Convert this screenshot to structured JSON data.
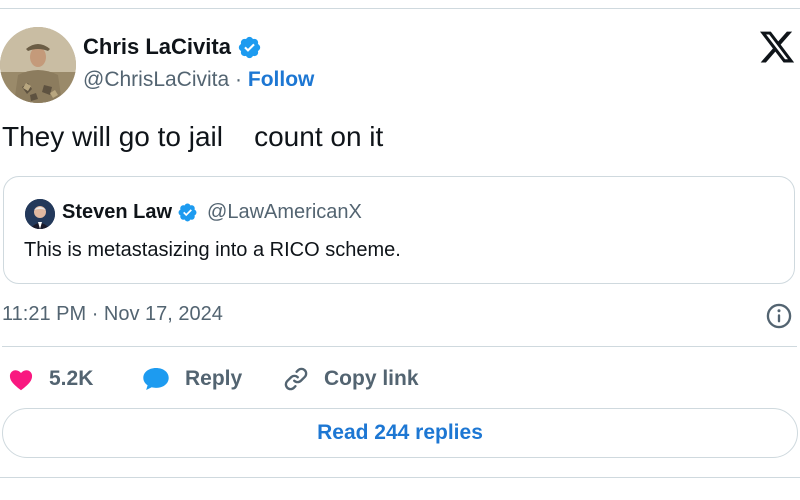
{
  "author": {
    "name": "Chris LaCivita",
    "handle": "@ChrisLaCivita",
    "separator": "·",
    "follow_label": "Follow"
  },
  "tweet": {
    "text": "They will go to jail    count on it"
  },
  "quote": {
    "name": "Steven Law",
    "handle": "@LawAmericanX",
    "text": "This is metastasizing into a RICO scheme."
  },
  "timestamp": {
    "time": "11:21 PM",
    "separator": "·",
    "date": "Nov 17, 2024"
  },
  "actions": {
    "likes_count": "5.2K",
    "reply_label": "Reply",
    "copy_link_label": "Copy link"
  },
  "read_replies_label": "Read 244 replies",
  "colors": {
    "accent": "#1d77d3",
    "like_heart": "#f91880",
    "reply_bubble": "#1d9bf0",
    "verified": "#1d9bf0",
    "muted_text": "#536471",
    "border": "#cfd9de"
  },
  "icons": {
    "like": "heart-icon",
    "reply": "speech-bubble-icon",
    "copy_link": "link-icon",
    "info": "info-icon",
    "brand": "x-logo-icon",
    "verified": "verified-badge-icon"
  }
}
